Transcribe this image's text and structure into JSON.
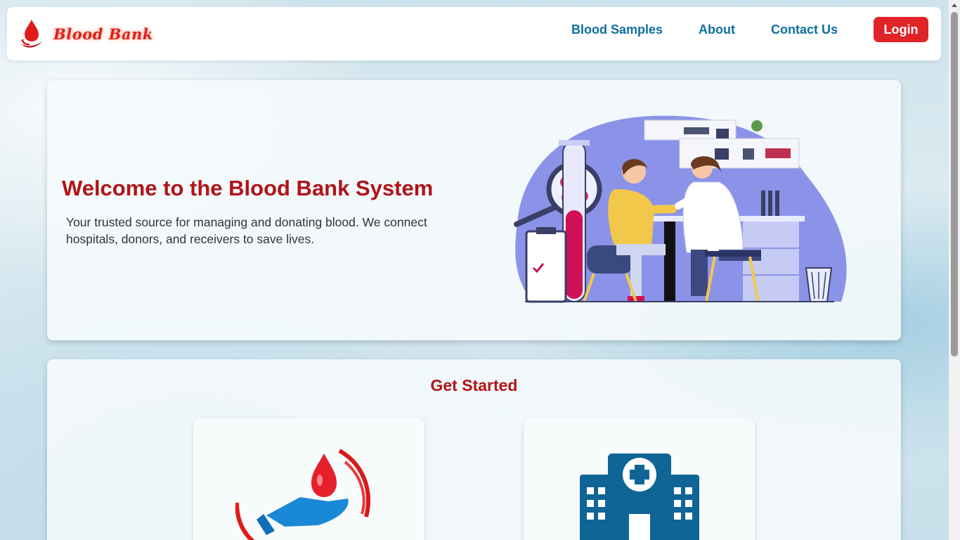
{
  "navbar": {
    "brand": "Blood Bank",
    "links": [
      "Blood Samples",
      "About",
      "Contact Us"
    ],
    "login_label": "Login"
  },
  "hero": {
    "title": "Welcome to the Blood Bank System",
    "description": "Your trusted source for managing and donating blood. We connect hospitals, donors, and receivers to save lives.",
    "illustration": "doctor-drawing-blood-illustration"
  },
  "get_started": {
    "title": "Get Started",
    "cards": [
      {
        "icon": "blood-donation-hand-icon"
      },
      {
        "icon": "hospital-building-icon"
      }
    ]
  },
  "colors": {
    "brand_red": "#e0242a",
    "heading_red": "#b01418",
    "nav_blue": "#0d6fa0",
    "hospital_blue": "#0f6596"
  }
}
